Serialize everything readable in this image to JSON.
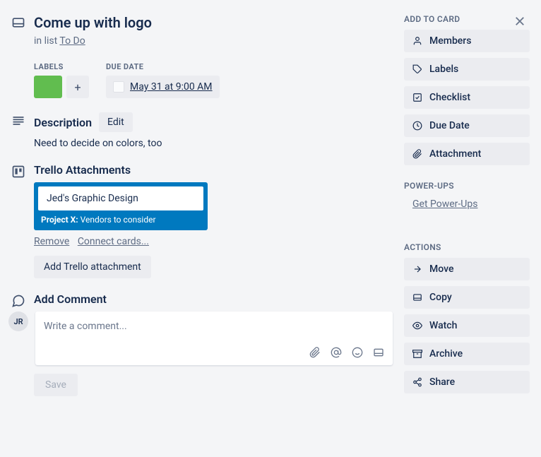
{
  "title": "Come up with logo",
  "in_list_prefix": "in list ",
  "in_list_link": "To Do",
  "meta": {
    "labels_label": "LABELS",
    "due_label": "DUE DATE",
    "due_value": "May 31 at 9:00 AM",
    "label_color": "#61bd4f"
  },
  "description": {
    "heading": "Description",
    "edit": "Edit",
    "text": "Need to decide on colors, too"
  },
  "attachments": {
    "heading": "Trello Attachments",
    "card_title": "Jed's Graphic Design",
    "card_sub_bold": "Project X:",
    "card_sub_rest": " Vendors to consider",
    "remove": "Remove",
    "connect": "Connect cards...",
    "add_button": "Add Trello attachment"
  },
  "comment": {
    "heading": "Add Comment",
    "avatar_initials": "JR",
    "placeholder": "Write a comment...",
    "save": "Save"
  },
  "sidebar": {
    "add_heading": "ADD TO CARD",
    "add_items": [
      "Members",
      "Labels",
      "Checklist",
      "Due Date",
      "Attachment"
    ],
    "powerups_heading": "POWER-UPS",
    "powerups_link": "Get Power-Ups",
    "actions_heading": "ACTIONS",
    "action_items": [
      "Move",
      "Copy",
      "Watch",
      "Archive",
      "Share"
    ]
  }
}
